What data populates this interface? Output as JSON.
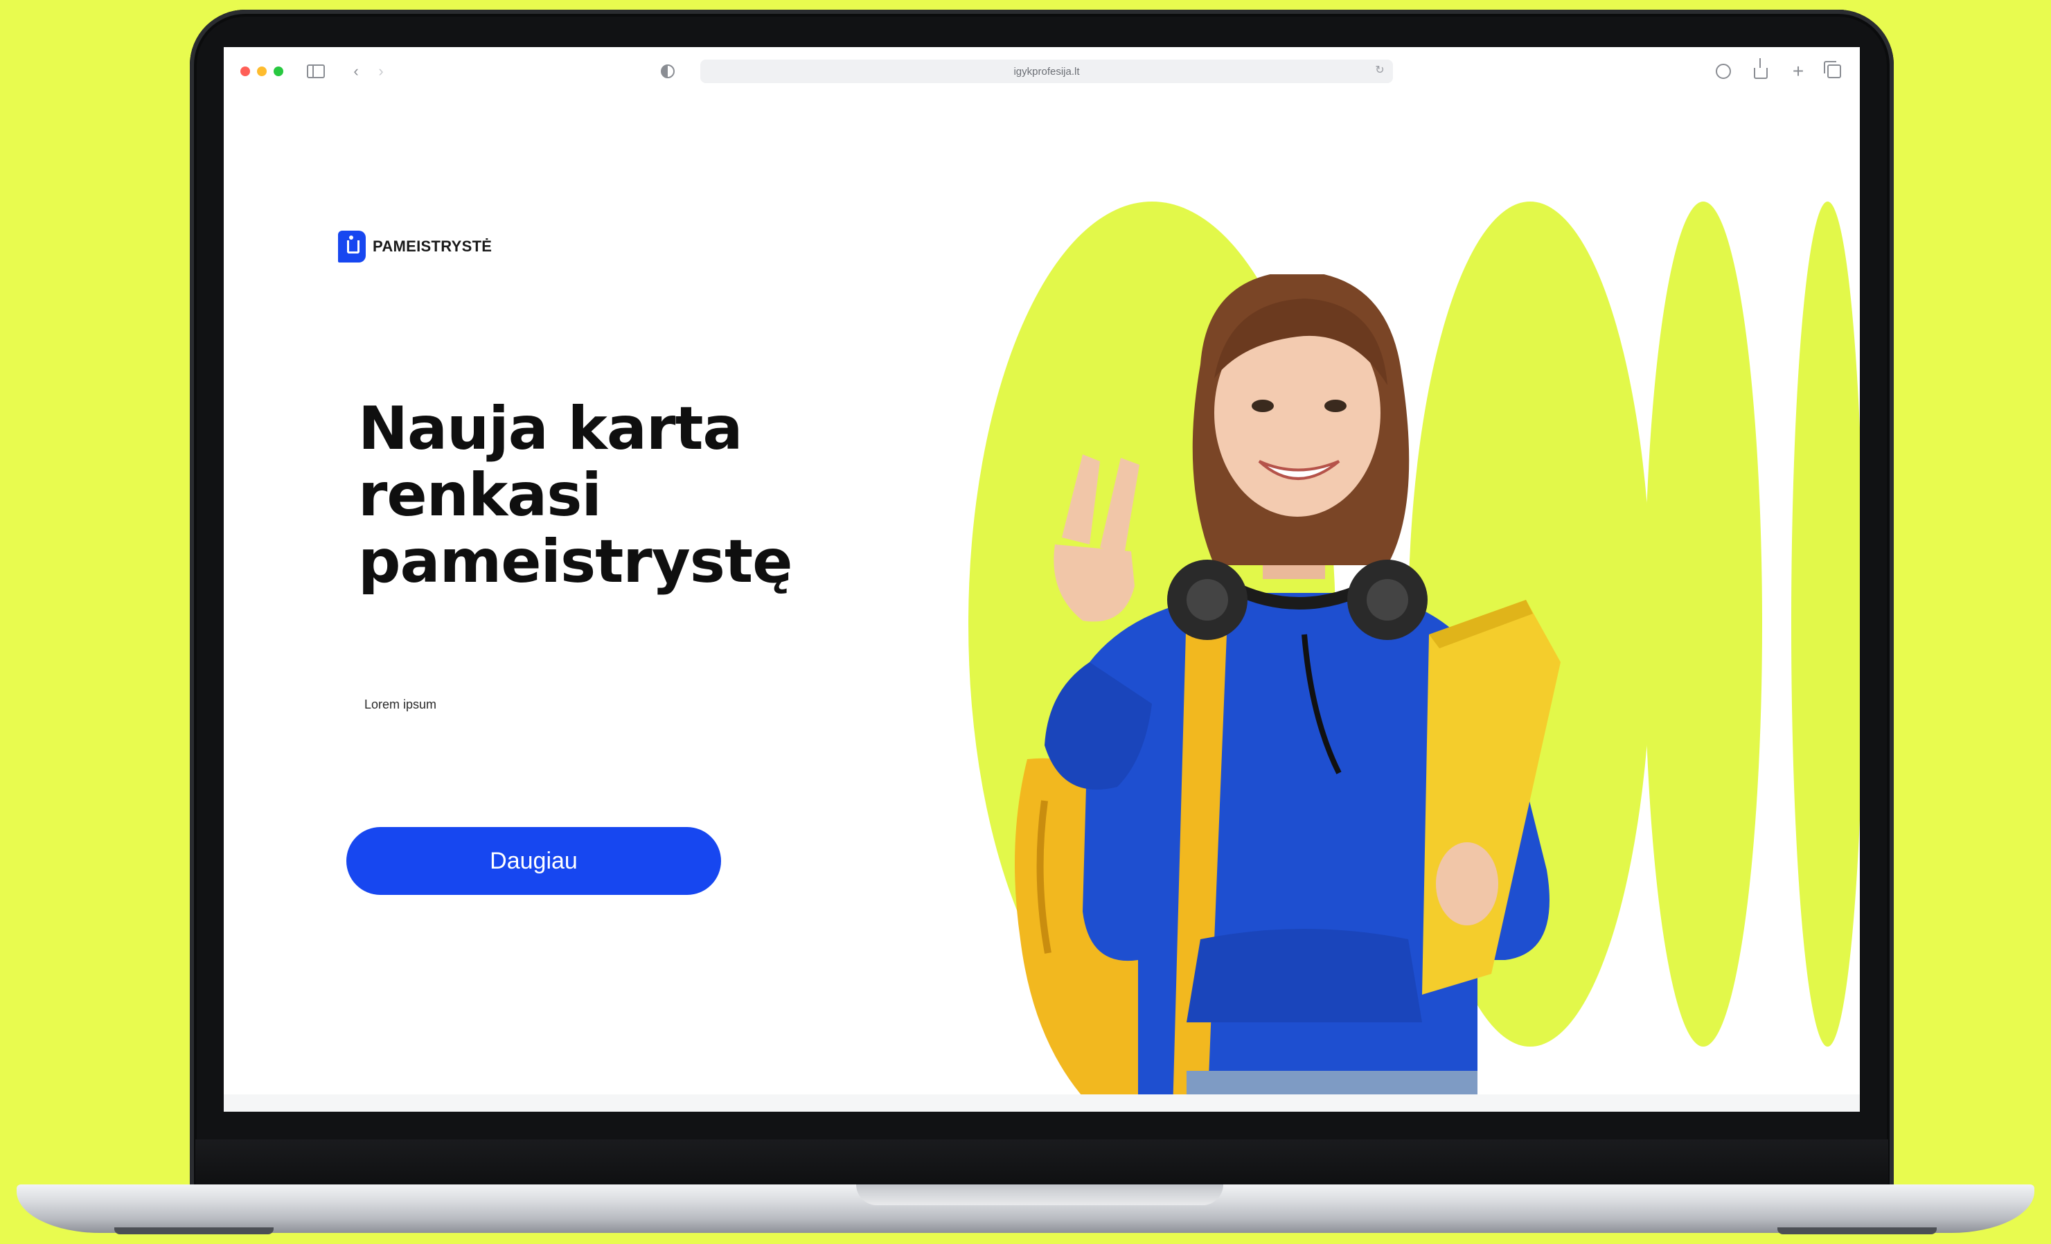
{
  "browser": {
    "url": "igykprofesija.lt"
  },
  "brand": {
    "name": "PAMEISTRYSTĖ"
  },
  "hero": {
    "headline_line1": "Nauja karta",
    "headline_line2": "renkasi",
    "headline_line3": "pameistrystę",
    "subtext": "Lorem ipsum",
    "cta_label": "Daugiau"
  },
  "colors": {
    "background": "#e8fb4f",
    "accent_lime": "#e2f84a",
    "brand_blue": "#1747f0",
    "text_dark": "#0f0f0f"
  },
  "icons": {
    "sidebar": "sidebar-icon",
    "back": "chevron-left-icon",
    "forward": "chevron-right-icon",
    "privacy": "shield-icon",
    "reload": "reload-icon",
    "download": "download-icon",
    "share": "share-icon",
    "new_tab": "plus-icon",
    "tabs": "tabs-icon"
  }
}
